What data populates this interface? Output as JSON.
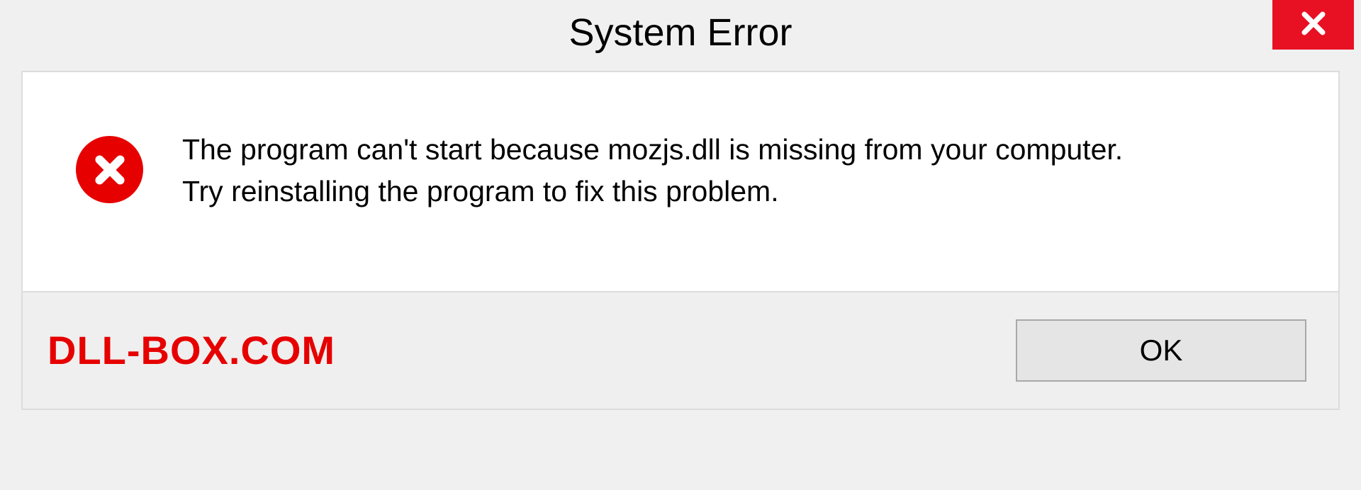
{
  "titlebar": {
    "title": "System Error",
    "close_icon": "close"
  },
  "dialog": {
    "icon": "error-circle-x",
    "message_line1": "The program can't start because mozjs.dll is missing from your computer.",
    "message_line2": "Try reinstalling the program to fix this problem."
  },
  "footer": {
    "brand": "DLL-BOX.COM",
    "ok_label": "OK"
  },
  "colors": {
    "close_bg": "#e81123",
    "error_icon_bg": "#e70000",
    "brand_color": "#e60000"
  }
}
